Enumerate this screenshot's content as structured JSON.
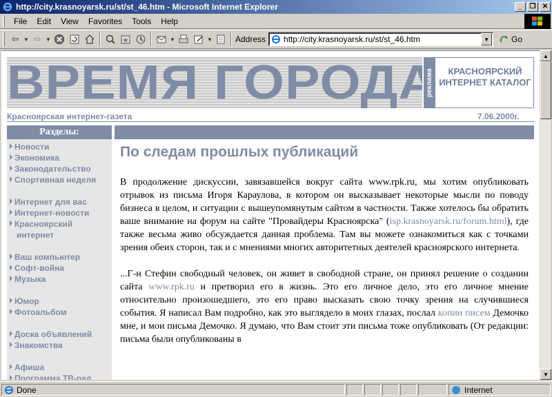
{
  "window": {
    "title": "http://city.krasnoyarsk.ru/st/st_46.htm - Microsoft Internet Explorer"
  },
  "menu": [
    "File",
    "Edit",
    "View",
    "Favorites",
    "Tools",
    "Help"
  ],
  "toolbar": {
    "address_label": "Address",
    "url": "http://city.krasnoyarsk.ru/st/st_46.htm",
    "go_label": "Go"
  },
  "site": {
    "logo_text": "ВРЕМЯ ГОРОДА",
    "promo_vertical": "реклама",
    "promo_text": "КРАСНОЯРСКИЙ ИНТЕРНЕТ КАТАЛОГ",
    "tagline": "Красноярская интернет-газета",
    "date": "7.06.2000г."
  },
  "sidebar": {
    "heading": "Разделы:",
    "links": [
      "Новости",
      "Экономика",
      "Законодательство",
      "Спортивная неделя",
      "Интернет для вас",
      "Интернет-новости",
      "Красноярский",
      "интернет",
      "Ваш компьютер",
      "Софт-война",
      "Музыка",
      "Юмор",
      "Фотоальбом",
      "Доска объявлений",
      "Знакомства",
      "Афиша",
      "Программа ТВ-рад"
    ]
  },
  "article": {
    "title": "По следам прошлых публикаций",
    "p1_a": "В продолжение дискуссии, завязавшейся вокруг сайта www.rpk.ru, мы хотим опубликовать отрывок из письма Игоря Караулова, в котором он высказывает некоторые мысли по поводу бизнеса в целом, и ситуации с вышеупомянутым сайтом в частности. Также хотелось бы обратить ваше внимание на форум на сайте \"Провайдеры Красноярска\" (",
    "p1_link": "isp.krasnoyarsk.ru/forum.html",
    "p1_b": "), где также весьма живо обсуждается данная проблема. Там вы можете ознакомиться как с точками зрения обеих сторон, так и с мнениями многих авторитетных деятелей красноярского интернета.",
    "p2_a": "...Г-н Стефин свободный человек, он живет в свободной стране, он принял решение о создании сайта ",
    "p2_link1": "www.rpk.ru",
    "p2_b": " и претворил его в жизнь. Это его личное дело, это его личное мнение относительно произошедшего, это его право высказать свою точку зрения на случившиеся события. Я написал Вам подробно, как это выглядело в моих глазах, послал ",
    "p2_link2": "копии писем",
    "p2_c": " Демочко мне, и мои письма Демочко. Я думаю, что Вам стоит эти письма тоже опубликовать (От редакции: письма были опубликованы в"
  },
  "status": {
    "left": "Done",
    "zone": "Internet"
  }
}
